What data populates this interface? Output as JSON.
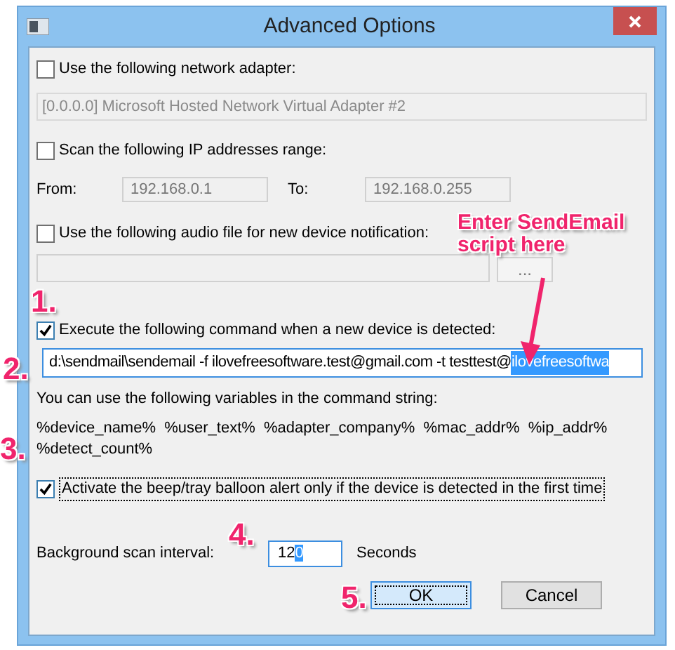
{
  "window": {
    "title": "Advanced Options"
  },
  "network_adapter": {
    "label": "Use the following network adapter:",
    "checked": false,
    "adapter": {
      "value": "[0.0.0.0]  Microsoft Hosted Network Virtual Adapter #2",
      "disabled": true
    }
  },
  "ip_range": {
    "label": "Scan the following IP addresses range:",
    "checked": false,
    "from_label": "From:",
    "from": "192.168.0.1",
    "to_label": "To:",
    "to": "192.168.0.255"
  },
  "audio": {
    "label": "Use the following audio file for new device notification:",
    "checked": false,
    "browse_button": "..."
  },
  "command": {
    "label": "Execute the following command when a new device is detected:",
    "checked": true,
    "value": "d:\\sendmail\\sendemail -f ilovefreesoftware.test@gmail.com -t testtest@",
    "selected_text": "ilovefreesoftwa"
  },
  "variables_hint": "You can use the following variables in the command string:",
  "variables": "%device_name%  %user_text%  %adapter_company%  %mac_addr%  %ip_addr%  %detect_count%",
  "alert": {
    "label": "Activate the beep/tray balloon alert only if the device is detected in the first time",
    "checked": true
  },
  "interval": {
    "label": "Background scan interval:",
    "value": "12",
    "selected_text": "0",
    "unit": "Seconds"
  },
  "buttons": [
    {
      "label": "OK",
      "default": true
    },
    {
      "label": "Cancel",
      "default": false
    }
  ],
  "annotations": [
    {
      "kind": "callout",
      "text": "Enter SendEmail script here"
    },
    {
      "kind": "step",
      "text": "1."
    },
    {
      "kind": "step",
      "text": "2."
    },
    {
      "kind": "step",
      "text": "3."
    },
    {
      "kind": "step",
      "text": "4."
    },
    {
      "kind": "step",
      "text": "5."
    }
  ]
}
